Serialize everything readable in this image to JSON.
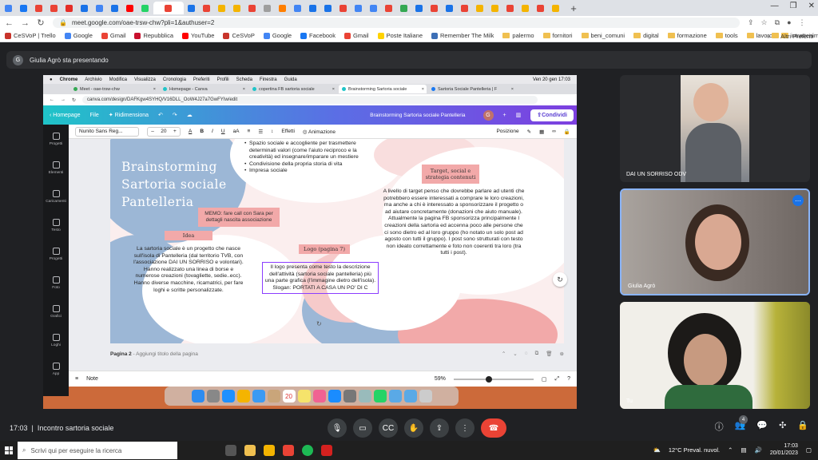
{
  "outer_browser": {
    "url": "meet.google.com/oae-trsw-chw?pli=1&authuser=2",
    "bookmarks": [
      "CeSVoP | Trello",
      "Google",
      "Gmail",
      "Repubblica",
      "YouTube",
      "CeSVoP",
      "Google",
      "Facebook",
      "Gmail",
      "Poste Italiane",
      "Remember The Milk",
      "palermo",
      "fornitori",
      "beni_comuni",
      "digital",
      "formazione",
      "tools",
      "lavoro",
      "intrattenimento"
    ],
    "bookmarks_more": "Altri Preferiti"
  },
  "meet": {
    "presenter_banner": "Giulia Agrò sta presentando",
    "presenter_initial": "G",
    "time": "17:03",
    "meeting_name": "Incontro sartoria sociale",
    "participants_count": "4",
    "participants": [
      {
        "name": "DAI UN SORRISO ODV"
      },
      {
        "name": "Giulia Agrò"
      },
      {
        "name": "Tu"
      }
    ]
  },
  "mac": {
    "menu": [
      "Chrome",
      "Archivio",
      "Modifica",
      "Visualizza",
      "Cronologia",
      "Preferiti",
      "Profili",
      "Scheda",
      "Finestra",
      "Guida"
    ],
    "datetime": "Ven 20 gen  17:03",
    "tabs": [
      "Meet - oae-trsw-chw",
      "Homepage - Canva",
      "copertina FB sartoria sociale",
      "Brainstorming Sartoria sociale",
      "Sartoria Sociale Pantelleria | F"
    ],
    "url": "canva.com/design/DAFKgw4SYHQ/V16DLL_OoW4J27a7GwFYIw/edit",
    "calendar_day": "20"
  },
  "canva": {
    "home": "Homepage",
    "file": "File",
    "resize": "Ridimensiona",
    "doc_title": "Brainstorming Sartoria sociale Pantelleria",
    "avatar_initial": "G",
    "share": "Condividi",
    "left_nav": [
      "Progetti",
      "Elementi",
      "Caricamenti",
      "Testo",
      "Progetti",
      "Foto",
      "Grafici",
      "Loghi",
      "App"
    ],
    "font": "Nunito Sans Reg...",
    "font_size": "20",
    "effects": "Effetti",
    "animation": "Animazione",
    "position": "Posizione",
    "page_label": "Pagina 2",
    "page_title_hint": "- Aggiungi titolo della pagina",
    "notes": "Note",
    "zoom": "59%"
  },
  "slide": {
    "title_lines": [
      "Brainstorming",
      "Sartoria sociale",
      "Pantelleria"
    ],
    "top_bullets_text": "Spazio sociale e accogliente per trasmettere determinati valori (come l'aiuto reciproco e la creatività) ed insegnare/imparare un mestiere",
    "bullets": [
      "Condivisione della propria storia di vita",
      "Impresa sociale"
    ],
    "memo": "MEMO: fare call con Sara per dettagli nascita associazione",
    "idea_label": "Idea",
    "idea_text": "La sartoria sociale è un progetto che nasce sull'isola di Pantelleria (dal territorio TVB, con l'associazione DAI UN SORRISO e volontari). Hanno realizzato una linea di borse e numerose creazioni (tovagliette, sedie..ecc). Hanno diverse macchine, ricamatrici, per fare loghi e scritte personalizzate.",
    "logo_label": "Logo (pagina 7)",
    "logo_text": "Il logo presenta come testo la descrizione dell'attività (sartoria sociale pantelleria) più una parte grafica (l'immagine dietro dell'isola).",
    "slogan": "Slogan: PORTATI A CASA UN PO' DI C",
    "target_label": "Target, social e strategia contenuti",
    "target_text": "A livello di target penso che dovrebbe parlare ad utenti che potrebbero essere interessati a comprare le loro creazioni, ma anche a chi è interessato a sponsorizzare il progetto o ad aiutare concretamente (donazioni che aiuto manuale). Attualmente la pagina FB sponsorizza principalmente l creazioni della sartoria ed accenna poco alle persone che ci sono dietro ed al loro gruppo (ho notato un solo post ad agosto con tutti il gruppo). I post sono strutturati con testo non ideato correttamente e foto non coerenti tra loro (tra tutti i post)."
  },
  "taskbar": {
    "search_placeholder": "Scrivi qui per eseguire la ricerca",
    "weather": "12°C  Preval. nuvol.",
    "time": "17:03",
    "date": "20/01/2023"
  },
  "colors": {
    "slide_blue": "#9cb7d6",
    "slide_pink": "#f2a9a9",
    "canva_purple": "#7d3fe0",
    "meet_red": "#ea4335"
  }
}
